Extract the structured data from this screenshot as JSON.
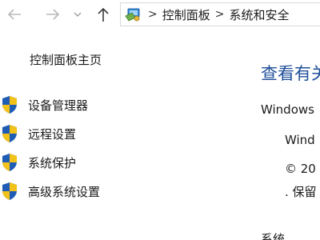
{
  "nav": {
    "back_icon": "arrow-left-icon",
    "forward_icon": "arrow-right-icon",
    "recent_icon": "chevron-down-icon",
    "up_icon": "arrow-up-icon"
  },
  "address": {
    "location_icon": "control-panel-icon",
    "separator": ">",
    "crumbs": [
      "控制面板",
      "系统和安全"
    ]
  },
  "left_pane": {
    "home_link": "控制面板主页",
    "tasks": [
      {
        "label": "设备管理器",
        "icon": "uac-shield-icon"
      },
      {
        "label": "远程设置",
        "icon": "uac-shield-icon"
      },
      {
        "label": "系统保护",
        "icon": "uac-shield-icon"
      },
      {
        "label": "高级系统设置",
        "icon": "uac-shield-icon"
      }
    ]
  },
  "main": {
    "title": "查看有关",
    "edition_heading": "Windows",
    "windows_name": "Wind",
    "copyright": "© 20",
    "rights": ". 保留",
    "system_heading": "系统"
  },
  "colors": {
    "title_blue": "#1e4f99",
    "text": "#1a1a1a",
    "shield_blue": "#1f5cb6",
    "shield_yellow": "#f2c21b"
  }
}
